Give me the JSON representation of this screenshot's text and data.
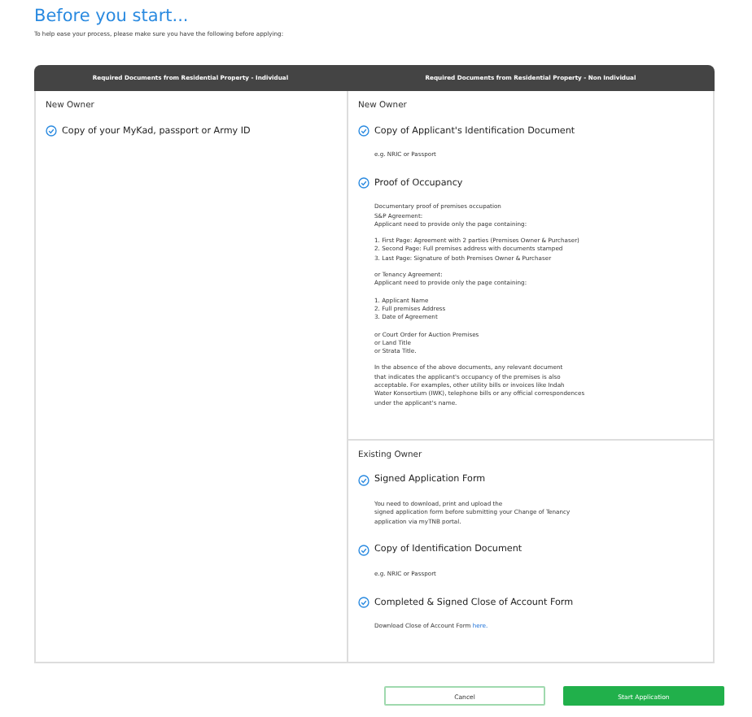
{
  "title": "Before you start...",
  "intro": "To help ease your process, please make sure you have the following before applying:",
  "columns": [
    {
      "header": "Required Documents from Residential Property - Individual",
      "sections": [
        {
          "heading": "New Owner",
          "items": [
            {
              "title": "Copy of your MyKad, passport or Army ID",
              "checked": true
            }
          ]
        }
      ]
    },
    {
      "header": "Required Documents from Residential Property - Non Individual",
      "sections": [
        {
          "heading": "New Owner",
          "items": [
            {
              "title": "Copy of Applicant's Identification Document",
              "checked": true,
              "details": [
                {
                  "text": "e.g. NRIC or Passport"
                }
              ]
            },
            {
              "title": "Proof of Occupancy",
              "checked": true,
              "details": [
                {
                  "text": "Documentary proof of premises occupation\nS&P Agreement:\nApplicant need to provide only the page containing:"
                },
                {
                  "text": "1. First Page: Agreement with 2 parties (Premises Owner & Purchaser)\n2. Second Page: Full premises address with documents stamped\n3. Last Page: Signature of both Premises Owner & Purchaser"
                },
                {
                  "text": "or Tenancy Agreement:\nApplicant need to provide only the page containing:"
                },
                {
                  "text": "1. Applicant Name\n2. Full premises Address\n3. Date of Agreement"
                },
                {
                  "text": "or Court Order for Auction Premises\nor Land Title\nor Strata Title."
                },
                {
                  "text": "In the absence of the above documents, any relevant document\nthat indicates the applicant's occupancy of the premises is also\nacceptable. For examples, other utility bills or invoices like Indah\nWater Konsortium (IWK), telephone bills or any official correspondences\nunder the applicant's name."
                }
              ]
            }
          ]
        },
        {
          "heading": "Existing Owner",
          "items": [
            {
              "title": "Signed Application Form",
              "checked": true,
              "details": [
                {
                  "text": "You need to download, print and upload the\nsigned application form before submitting your Change of Tenancy\napplication via myTNB portal."
                }
              ]
            },
            {
              "title": "Copy of Identification Document",
              "checked": true,
              "details": [
                {
                  "text": "e.g. NRIC or Passport"
                }
              ]
            },
            {
              "title": "Completed & Signed Close of Account Form",
              "checked": true,
              "details": [
                {
                  "text": "Download Close of Account Form ",
                  "link": "here."
                }
              ]
            }
          ]
        }
      ]
    }
  ],
  "buttons": [
    {
      "label": "Cancel",
      "kind": "secondary"
    },
    {
      "label": "Start Application",
      "kind": "primary"
    }
  ]
}
